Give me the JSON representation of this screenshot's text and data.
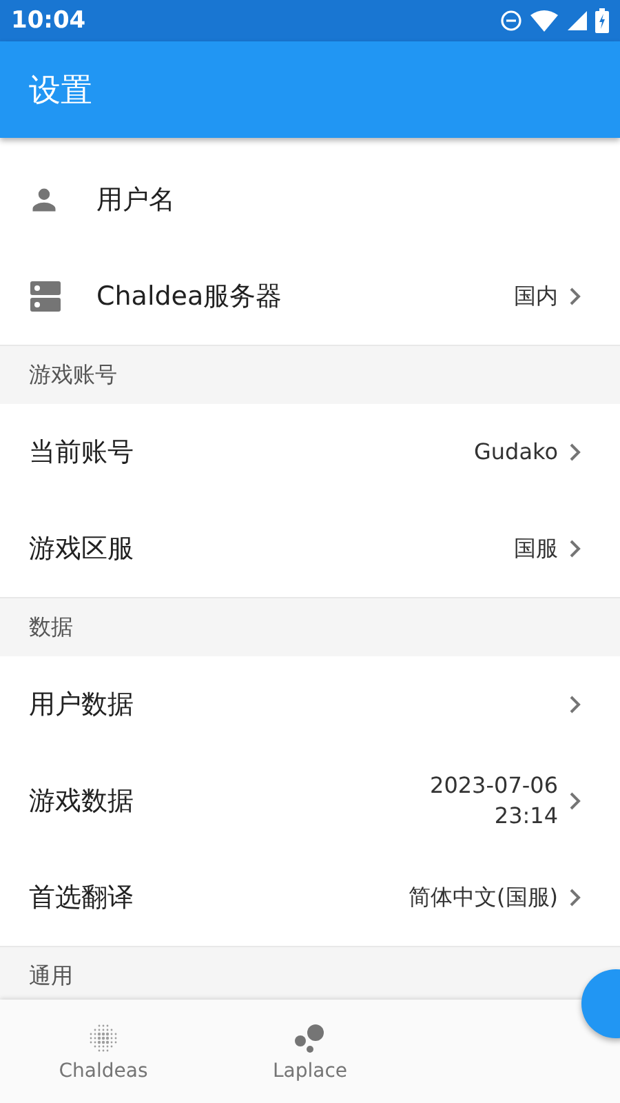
{
  "status_bar": {
    "time": "10:04"
  },
  "app_bar": {
    "title": "设置"
  },
  "sections": [
    {
      "items": [
        {
          "kind": "person",
          "label": "用户名"
        },
        {
          "kind": "server",
          "label": "Chaldea服务器",
          "value": "国内",
          "chevron": true
        }
      ]
    },
    {
      "header": "游戏账号",
      "items": [
        {
          "label": "当前账号",
          "value": "Gudako",
          "chevron": true
        },
        {
          "label": "游戏区服",
          "value": "国服",
          "chevron": true
        }
      ]
    },
    {
      "header": "数据",
      "items": [
        {
          "label": "用户数据",
          "chevron": true
        },
        {
          "label": "游戏数据",
          "value": "2023-07-06\n23:14",
          "chevron": true
        },
        {
          "label": "首选翻译",
          "value": "简体中文(国服)",
          "chevron": true
        }
      ]
    },
    {
      "header": "通用"
    }
  ],
  "bottom_nav": [
    {
      "kind": "dots",
      "label": "Chaldeas"
    },
    {
      "kind": "bubbles",
      "label": "Laplace"
    }
  ]
}
